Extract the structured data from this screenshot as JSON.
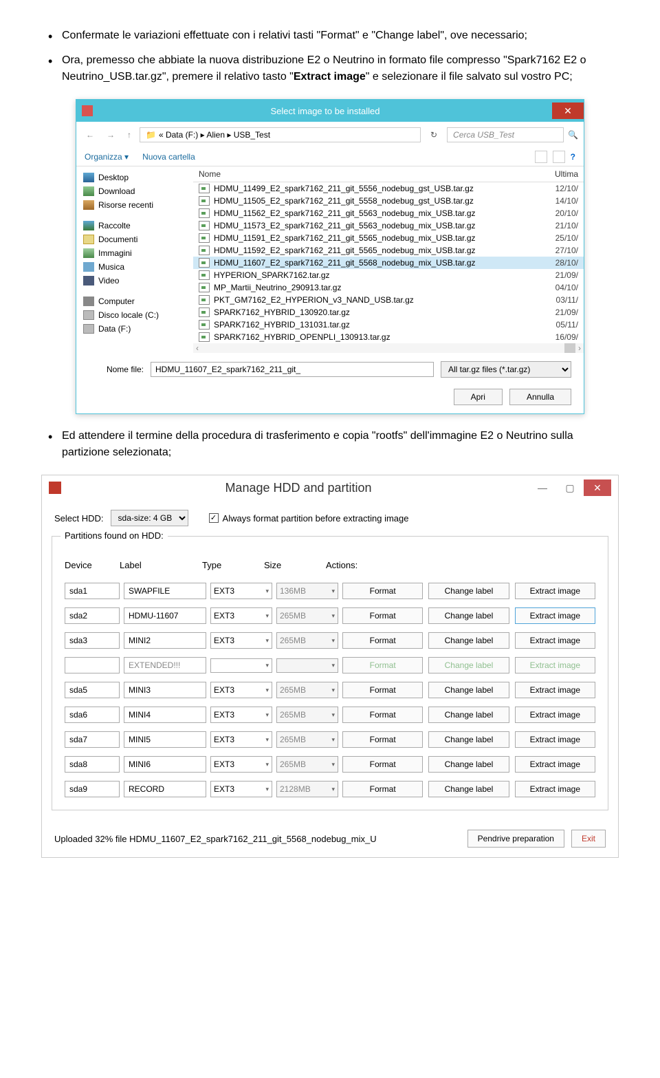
{
  "para1": {
    "p1": "Confermate le variazioni effettuate con i relativi tasti \"Format\" e \"Change label\", ove necessario;",
    "p2a": "Ora, premesso che abbiate la nuova distribuzione E2 o Neutrino in formato file compresso \"Spark7162 E2 o Neutrino_USB.tar.gz\", premere il relativo tasto \"",
    "p2b": "Extract image",
    "p2c": "\" e selezionare il file salvato sul vostro PC;"
  },
  "explorer": {
    "title": "Select image to be installed",
    "path": "« Data (F:) ▸ Alien ▸ USB_Test",
    "search_placeholder": "Cerca USB_Test",
    "organize": "Organizza ▾",
    "new_folder": "Nuova cartella",
    "sidebar": {
      "desktop": "Desktop",
      "download": "Download",
      "recent": "Risorse recenti",
      "collections": "Raccolte",
      "documents": "Documenti",
      "images": "Immagini",
      "music": "Musica",
      "video": "Video",
      "computer": "Computer",
      "localdisk": "Disco locale (C:)",
      "dataf": "Data (F:)"
    },
    "cols": {
      "name": "Nome",
      "date": "Ultima"
    },
    "files": [
      {
        "name": "HDMU_11499_E2_spark7162_211_git_5556_nodebug_gst_USB.tar.gz",
        "date": "12/10/"
      },
      {
        "name": "HDMU_11505_E2_spark7162_211_git_5558_nodebug_gst_USB.tar.gz",
        "date": "14/10/"
      },
      {
        "name": "HDMU_11562_E2_spark7162_211_git_5563_nodebug_mix_USB.tar.gz",
        "date": "20/10/"
      },
      {
        "name": "HDMU_11573_E2_spark7162_211_git_5563_nodebug_mix_USB.tar.gz",
        "date": "21/10/"
      },
      {
        "name": "HDMU_11591_E2_spark7162_211_git_5565_nodebug_mix_USB.tar.gz",
        "date": "25/10/"
      },
      {
        "name": "HDMU_11592_E2_spark7162_211_git_5565_nodebug_mix_USB.tar.gz",
        "date": "27/10/"
      },
      {
        "name": "HDMU_11607_E2_spark7162_211_git_5568_nodebug_mix_USB.tar.gz",
        "date": "28/10/"
      },
      {
        "name": "HYPERION_SPARK7162.tar.gz",
        "date": "21/09/"
      },
      {
        "name": "MP_Martii_Neutrino_290913.tar.gz",
        "date": "04/10/"
      },
      {
        "name": "PKT_GM7162_E2_HYPERION_v3_NAND_USB.tar.gz",
        "date": "03/11/"
      },
      {
        "name": "SPARK7162_HYBRID_130920.tar.gz",
        "date": "21/09/"
      },
      {
        "name": "SPARK7162_HYBRID_131031.tar.gz",
        "date": "05/11/"
      },
      {
        "name": "SPARK7162_HYBRID_OPENPLI_130913.tar.gz",
        "date": "16/09/"
      }
    ],
    "selected_index": 6,
    "filename_label": "Nome file:",
    "filename_value": "HDMU_11607_E2_spark7162_211_git_",
    "filter": "All tar.gz files (*.tar.gz)",
    "open": "Apri",
    "cancel": "Annulla"
  },
  "para2": "Ed attendere il termine della procedura di trasferimento e copia \"rootfs\" dell'immagine E2 o Neutrino sulla partizione selezionata;",
  "win2": {
    "title": "Manage HDD and partition",
    "select_hdd_label": "Select HDD:",
    "select_hdd_value": "sda-size: 4 GB",
    "always_format": "Always format partition before extracting image",
    "fieldset_label": "Partitions found on HDD:",
    "headers": {
      "device": "Device",
      "label": "Label",
      "type": "Type",
      "size": "Size",
      "actions": "Actions:"
    },
    "rows": [
      {
        "device": "sda1",
        "label": "SWAPFILE",
        "type": "EXT3",
        "size": "136MB",
        "ext": false,
        "hl": false
      },
      {
        "device": "sda2",
        "label": "HDMU-11607",
        "type": "EXT3",
        "size": "265MB",
        "ext": false,
        "hl": true
      },
      {
        "device": "sda3",
        "label": "MINI2",
        "type": "EXT3",
        "size": "265MB",
        "ext": false,
        "hl": false
      },
      {
        "device": "",
        "label": "EXTENDED!!!",
        "type": "",
        "size": "",
        "ext": true,
        "hl": false
      },
      {
        "device": "sda5",
        "label": "MINI3",
        "type": "EXT3",
        "size": "265MB",
        "ext": false,
        "hl": false
      },
      {
        "device": "sda6",
        "label": "MINI4",
        "type": "EXT3",
        "size": "265MB",
        "ext": false,
        "hl": false
      },
      {
        "device": "sda7",
        "label": "MINI5",
        "type": "EXT3",
        "size": "265MB",
        "ext": false,
        "hl": false
      },
      {
        "device": "sda8",
        "label": "MINI6",
        "type": "EXT3",
        "size": "265MB",
        "ext": false,
        "hl": false
      },
      {
        "device": "sda9",
        "label": "RECORD",
        "type": "EXT3",
        "size": "2128MB",
        "ext": false,
        "hl": false
      }
    ],
    "btn_format": "Format",
    "btn_change": "Change label",
    "btn_extract": "Extract image",
    "status": "Uploaded 32% file HDMU_11607_E2_spark7162_211_git_5568_nodebug_mix_U",
    "pendrive": "Pendrive preparation",
    "exit": "Exit"
  }
}
